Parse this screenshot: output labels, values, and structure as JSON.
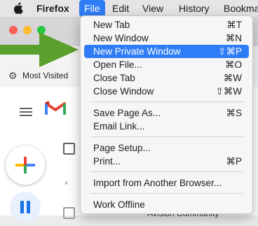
{
  "menubar": {
    "apple_icon": "apple-logo-icon",
    "items": [
      "Firefox",
      "File",
      "Edit",
      "View",
      "History",
      "Bookma"
    ]
  },
  "window": {
    "bookmarks_bar": {
      "most_visited_label": "Most Visited"
    },
    "partial_text": "Avision Community"
  },
  "file_menu": {
    "items": [
      {
        "label": "New Tab",
        "shortcut": "⌘T"
      },
      {
        "label": "New Window",
        "shortcut": "⌘N"
      },
      {
        "label": "New Private Window",
        "shortcut": "⇧⌘P",
        "highlighted": true
      },
      {
        "label": "Open File...",
        "shortcut": "⌘O"
      },
      {
        "label": "Close Tab",
        "shortcut": "⌘W"
      },
      {
        "label": "Close Window",
        "shortcut": "⇧⌘W"
      },
      {
        "label": "Save Page As...",
        "shortcut": "⌘S"
      },
      {
        "label": "Email Link...",
        "shortcut": ""
      },
      {
        "label": "Page Setup...",
        "shortcut": ""
      },
      {
        "label": "Print...",
        "shortcut": "⌘P"
      },
      {
        "label": "Import from Another Browser...",
        "shortcut": ""
      },
      {
        "label": "Work Offline",
        "shortcut": ""
      }
    ]
  },
  "colors": {
    "highlight": "#2f7df6",
    "arrow": "#5aa02c"
  }
}
